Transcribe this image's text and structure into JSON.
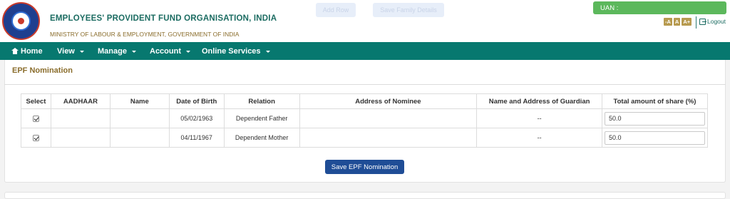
{
  "header": {
    "org_title": "EMPLOYEES' PROVIDENT FUND ORGANISATION, INDIA",
    "ministry": "MINISTRY OF LABOUR & EMPLOYMENT, GOVERNMENT OF INDIA",
    "ghost_button_1": "Add Row",
    "ghost_button_2": "Save Family Details",
    "uan_label": "UAN :",
    "font_decrease": "-A",
    "font_normal": "A",
    "font_increase": "A+",
    "logout": "Logout"
  },
  "nav": {
    "home": "Home",
    "view": "View",
    "manage": "Manage",
    "account": "Account",
    "online_services": "Online Services"
  },
  "section": {
    "title": "EPF Nomination"
  },
  "table": {
    "headers": [
      "Select",
      "AADHAAR",
      "Name",
      "Date of Birth",
      "Relation",
      "Address of Nominee",
      "Name and Address of Guardian",
      "Total amount of share (%)"
    ],
    "rows": [
      {
        "select": true,
        "aadhaar": "",
        "name": "",
        "dob": "05/02/1963",
        "relation": "Dependent Father",
        "address": "",
        "guardian": "--",
        "share": "50.0"
      },
      {
        "select": true,
        "aadhaar": "",
        "name": "",
        "dob": "04/11/1967",
        "relation": "Dependent Mother",
        "address": "",
        "guardian": "--",
        "share": "50.0"
      }
    ]
  },
  "save_button": "Save EPF Nomination",
  "colors": {
    "navbar": "#07786f",
    "title_teal": "#1c6c62",
    "section_gold": "#8a6d2c",
    "save_button": "#1f4d96",
    "uan_green": "#5cb85c"
  }
}
